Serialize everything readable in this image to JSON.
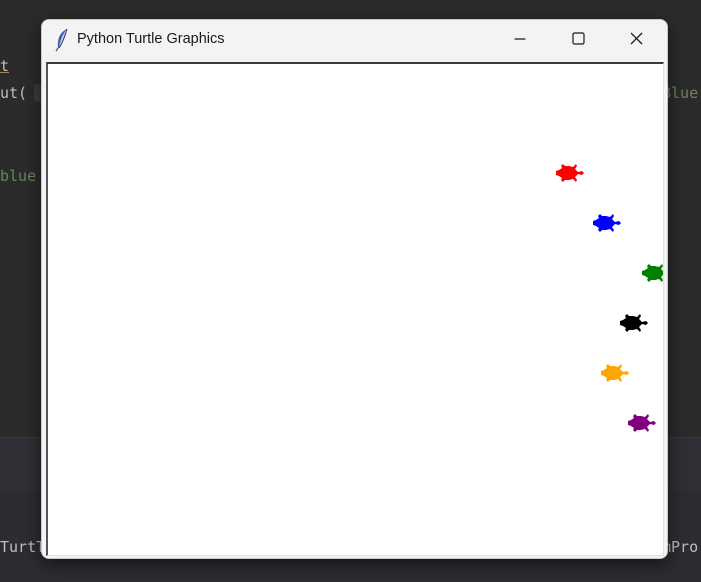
{
  "window": {
    "title": "Python Turtle Graphics"
  },
  "ide_background": {
    "line1": "t",
    "line2": "ut(",
    "line2_right": "Blue",
    "line3": "blue",
    "bottom_left": "TurtT",
    "bottom_right": "mPro"
  },
  "turtles": [
    {
      "color": "#ff0000",
      "heading": "east"
    },
    {
      "color": "#0000ff",
      "heading": "east"
    },
    {
      "color": "#008000",
      "heading": "east"
    },
    {
      "color": "#000000",
      "heading": "east"
    },
    {
      "color": "#ffa500",
      "heading": "east"
    },
    {
      "color": "#800080",
      "heading": "east"
    }
  ],
  "icons": {
    "app": "feather-icon",
    "minimize": "minimize-icon",
    "maximize": "maximize-icon",
    "close": "close-icon"
  }
}
